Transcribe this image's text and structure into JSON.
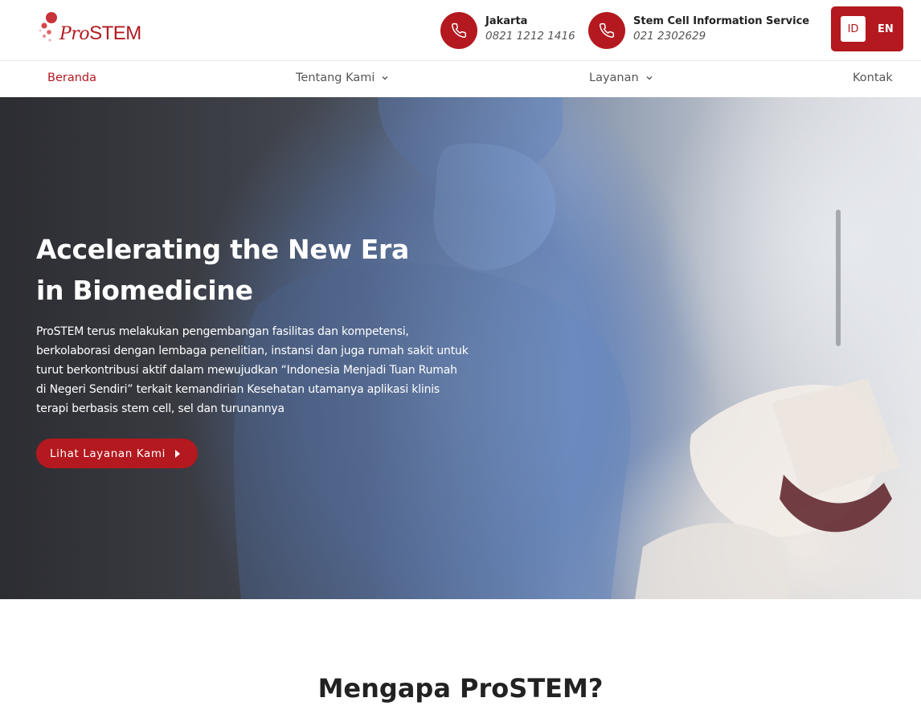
{
  "header": {
    "logo": {
      "prefix": "Pro",
      "suffix": "STEM",
      "icon": "prostem-logo-dots"
    },
    "contacts": [
      {
        "title": "Jakarta",
        "phone": "0821 1212 1416",
        "icon": "phone-icon"
      },
      {
        "title": "Stem Cell Information Service",
        "phone": "021 2302629",
        "icon": "phone-icon"
      }
    ],
    "languages": {
      "active": "ID",
      "other": "EN"
    }
  },
  "nav": {
    "items": [
      {
        "label": "Beranda",
        "active": true
      },
      {
        "label": "Tentang Kami",
        "dropdown": true
      },
      {
        "label": "Layanan",
        "dropdown": true
      },
      {
        "label": "Kontak"
      }
    ]
  },
  "hero": {
    "title_line1": "Accelerating the New Era",
    "title_line2": "in Biomedicine",
    "description": "ProSTEM terus melakukan pengembangan fasilitas dan kompetensi, berkolaborasi dengan lembaga penelitian, instansi dan juga rumah sakit untuk turut berkontribusi aktif dalam mewujudkan “Indonesia Menjadi Tuan Rumah di Negeri Sendiri” terkait kemandirian Kesehatan utamanya aplikasi klinis terapi berbasis stem cell, sel dan turunannya",
    "button_label": "Lihat Layanan Kami"
  },
  "section": {
    "title": "Mengapa ProSTEM?"
  },
  "colors": {
    "brand": "#b3191f",
    "text": "#222222",
    "nav_text": "#555555"
  }
}
